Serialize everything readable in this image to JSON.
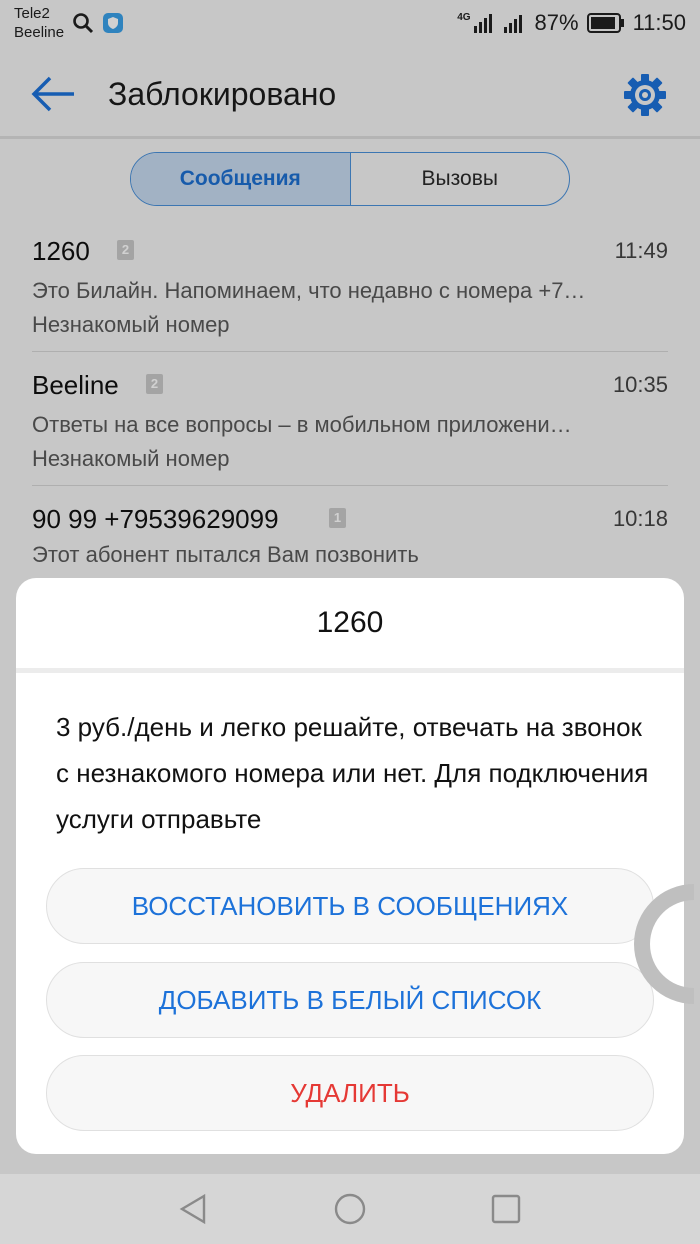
{
  "status": {
    "carrier1": "Tele2",
    "carrier2": "Beeline",
    "network": "4G",
    "battery": "87%",
    "time": "11:50"
  },
  "header": {
    "title": "Заблокировано"
  },
  "tabs": [
    {
      "label": "Сообщения",
      "active": true
    },
    {
      "label": "Вызовы",
      "active": false
    }
  ],
  "messages": [
    {
      "sender": "1260",
      "sim": "2",
      "time": "11:49",
      "preview": "Это Билайн. Напоминаем, что недавно с номера +7…",
      "note": "Незнакомый номер"
    },
    {
      "sender": "Beeline",
      "sim": "2",
      "time": "10:35",
      "preview": "Ответы на все вопросы – в мобильном приложени…",
      "note": "Незнакомый номер"
    },
    {
      "sender": "90 99 +79539629099",
      "sim": "1",
      "time": "10:18",
      "preview": "Этот абонент пытался Вам позвонить",
      "note": ""
    }
  ],
  "dialog": {
    "title": "1260",
    "body": "3 руб./день и легко решайте, отвечать на звонок с незнакомого номера или нет. Для подключения услуги отправьте",
    "buttons": {
      "restore": "ВОССТАНОВИТЬ В СООБЩЕНИЯХ",
      "whitelist": "ДОБАВИТЬ В БЕЛЫЙ СПИСОК",
      "delete": "УДАЛИТЬ"
    }
  },
  "colors": {
    "accent": "#1d72d9",
    "danger": "#e53935",
    "tab_active_bg": "#c6d9ef"
  }
}
